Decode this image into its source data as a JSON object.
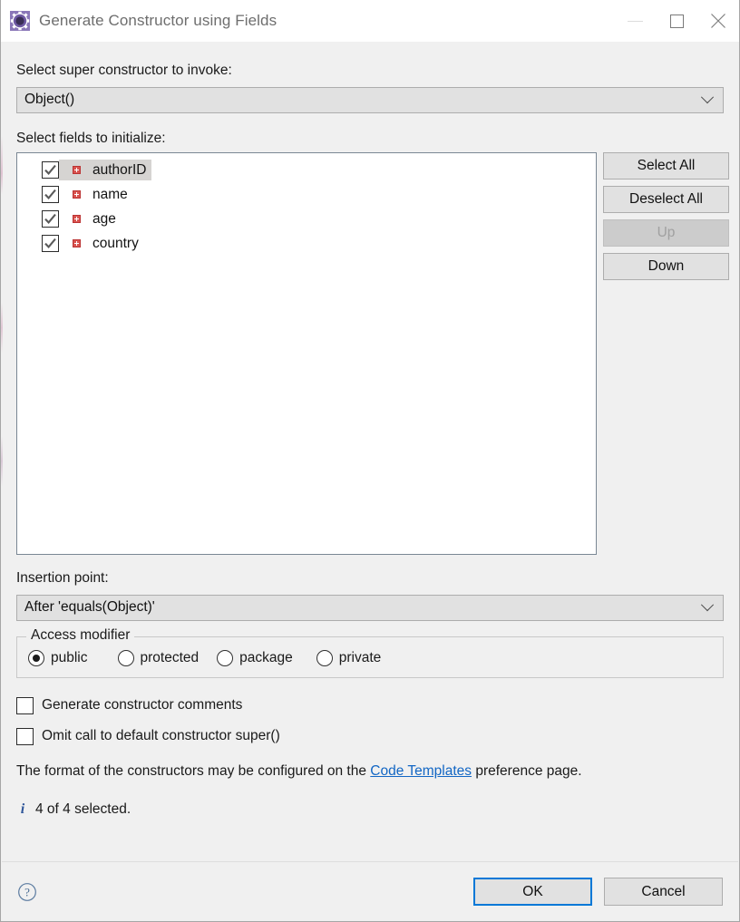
{
  "window": {
    "title": "Generate Constructor using Fields",
    "icon": "eclipse-gear-icon",
    "minimize_label": "Minimize",
    "maximize_label": "Maximize",
    "close_label": "Close"
  },
  "super_constructor": {
    "label": "Select super constructor to invoke:",
    "value": "Object()",
    "options": [
      "Object()"
    ]
  },
  "fields": {
    "label": "Select fields to initialize:",
    "items": [
      {
        "name": "authorID",
        "checked": true,
        "selected": true,
        "visibility": "private"
      },
      {
        "name": "name",
        "checked": true,
        "selected": false,
        "visibility": "private"
      },
      {
        "name": "age",
        "checked": true,
        "selected": false,
        "visibility": "private"
      },
      {
        "name": "country",
        "checked": true,
        "selected": false,
        "visibility": "private"
      }
    ]
  },
  "side_buttons": {
    "select_all": "Select All",
    "deselect_all": "Deselect All",
    "up": "Up",
    "down": "Down",
    "up_disabled": true
  },
  "insertion_point": {
    "label": "Insertion point:",
    "value": "After 'equals(Object)'",
    "options": [
      "After 'equals(Object)'"
    ]
  },
  "access_modifier": {
    "legend": "Access modifier",
    "options": [
      {
        "label": "public",
        "checked": true
      },
      {
        "label": "protected",
        "checked": false
      },
      {
        "label": "package",
        "checked": false
      },
      {
        "label": "private",
        "checked": false
      }
    ]
  },
  "options": [
    {
      "label": "Generate constructor comments",
      "checked": false
    },
    {
      "label": "Omit call to default constructor super()",
      "checked": false
    }
  ],
  "hint": {
    "prefix": "The format of the constructors may be configured on the ",
    "link": "Code Templates",
    "suffix": " preference page."
  },
  "status": {
    "icon": "info-icon",
    "text": "4 of 4 selected."
  },
  "footer": {
    "help_label": "?",
    "ok": "OK",
    "cancel": "Cancel"
  },
  "colors": {
    "accent": "#0078d7",
    "link": "#1266c4",
    "info": "#2f5699",
    "dialog_bg": "#f0f0f0",
    "control_bg": "#e1e1e1",
    "field_icon": "#d9534f",
    "selection": "#d6d4d2"
  }
}
